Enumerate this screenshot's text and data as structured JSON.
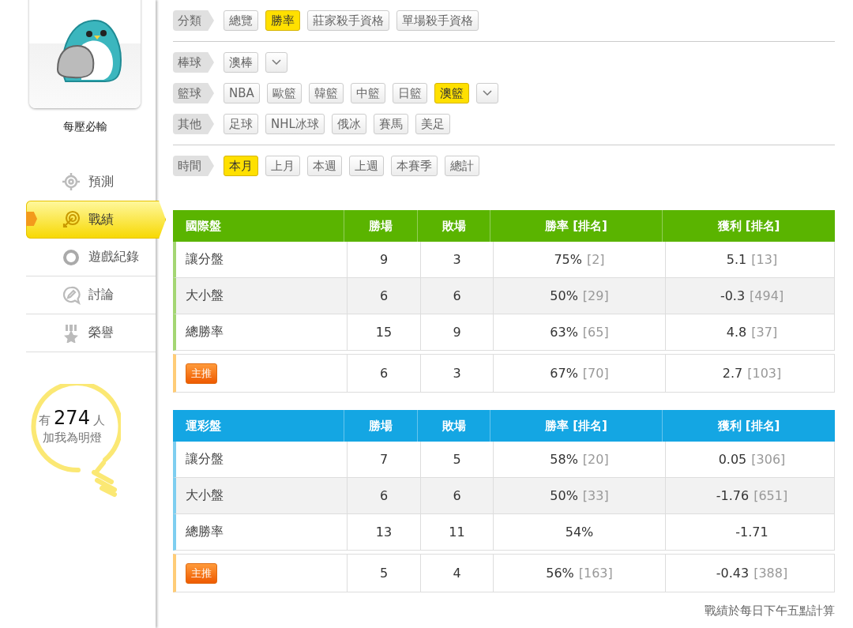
{
  "sidebar": {
    "username": "每壓必輸",
    "menu": [
      {
        "label": "預測",
        "selected": false
      },
      {
        "label": "戰績",
        "selected": true
      },
      {
        "label": "遊戲紀錄",
        "selected": false
      },
      {
        "label": "討論",
        "selected": false
      },
      {
        "label": "榮譽",
        "selected": false
      }
    ],
    "fans": {
      "prefix": "有",
      "count": "274",
      "suffix": "人",
      "caption": "加我為明燈"
    }
  },
  "filters": [
    {
      "label": "分類",
      "dropdown": false,
      "options": [
        {
          "label": "總覽",
          "selected": false
        },
        {
          "label": "勝率",
          "selected": true
        },
        {
          "label": "莊家殺手資格",
          "selected": false
        },
        {
          "label": "單場殺手資格",
          "selected": false
        }
      ]
    },
    {
      "label": "棒球",
      "dropdown": true,
      "options": [
        {
          "label": "澳棒",
          "selected": false
        }
      ]
    },
    {
      "label": "籃球",
      "dropdown": true,
      "options": [
        {
          "label": "NBA",
          "selected": false
        },
        {
          "label": "歐籃",
          "selected": false
        },
        {
          "label": "韓籃",
          "selected": false
        },
        {
          "label": "中籃",
          "selected": false
        },
        {
          "label": "日籃",
          "selected": false
        },
        {
          "label": "澳籃",
          "selected": true
        }
      ]
    },
    {
      "label": "其他",
      "dropdown": false,
      "options": [
        {
          "label": "足球",
          "selected": false
        },
        {
          "label": "NHL冰球",
          "selected": false
        },
        {
          "label": "俄冰",
          "selected": false
        },
        {
          "label": "賽馬",
          "selected": false
        },
        {
          "label": "美足",
          "selected": false
        }
      ]
    },
    {
      "label": "時間",
      "dropdown": false,
      "options": [
        {
          "label": "本月",
          "selected": true
        },
        {
          "label": "上月",
          "selected": false
        },
        {
          "label": "本週",
          "selected": false
        },
        {
          "label": "上週",
          "selected": false
        },
        {
          "label": "本賽季",
          "selected": false
        },
        {
          "label": "總計",
          "selected": false
        }
      ]
    }
  ],
  "tables": [
    {
      "color": "#5ab400",
      "columns": [
        "國際盤",
        "勝場",
        "敗場",
        "勝率 [排名]",
        "獲利 [排名]"
      ],
      "rows": [
        {
          "kind": "normal",
          "label": "讓分盤",
          "wins": "9",
          "losses": "3",
          "rate": "75%",
          "rate_rank": "[2]",
          "profit": "5.1",
          "profit_rank": "[13]"
        },
        {
          "kind": "normal",
          "label": "大小盤",
          "wins": "6",
          "losses": "6",
          "rate": "50%",
          "rate_rank": "[29]",
          "profit": "-0.3",
          "profit_rank": "[494]"
        },
        {
          "kind": "normal",
          "label": "總勝率",
          "wins": "15",
          "losses": "9",
          "rate": "63%",
          "rate_rank": "[65]",
          "profit": "4.8",
          "profit_rank": "[37]"
        },
        {
          "kind": "featured",
          "label": "主推",
          "wins": "6",
          "losses": "3",
          "rate": "67%",
          "rate_rank": "[70]",
          "profit": "2.7",
          "profit_rank": "[103]"
        }
      ]
    },
    {
      "color": "#14a6e3",
      "columns": [
        "運彩盤",
        "勝場",
        "敗場",
        "勝率 [排名]",
        "獲利 [排名]"
      ],
      "rows": [
        {
          "kind": "normal",
          "label": "讓分盤",
          "wins": "7",
          "losses": "5",
          "rate": "58%",
          "rate_rank": "[20]",
          "profit": "0.05",
          "profit_rank": "[306]"
        },
        {
          "kind": "normal",
          "label": "大小盤",
          "wins": "6",
          "losses": "6",
          "rate": "50%",
          "rate_rank": "[33]",
          "profit": "-1.76",
          "profit_rank": "[651]"
        },
        {
          "kind": "normal",
          "label": "總勝率",
          "wins": "13",
          "losses": "11",
          "rate": "54%",
          "profit": "-1.71"
        },
        {
          "kind": "featured",
          "label": "主推",
          "wins": "5",
          "losses": "4",
          "rate": "56%",
          "rate_rank": "[163]",
          "profit": "-0.43",
          "profit_rank": "[388]"
        }
      ]
    }
  ],
  "footnote": "戰績於每日下午五點計算"
}
